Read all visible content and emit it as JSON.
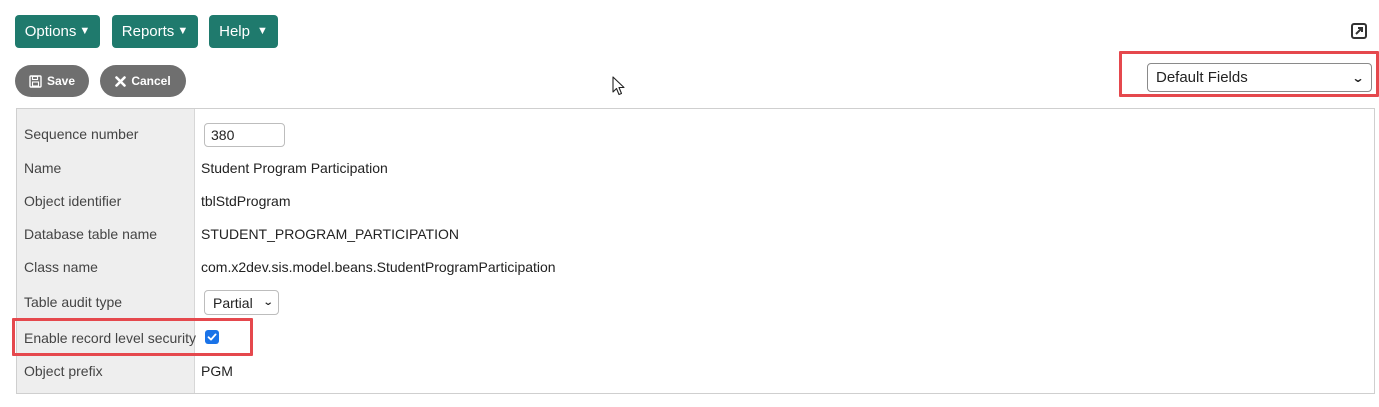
{
  "menu": {
    "options_label": "Options",
    "reports_label": "Reports",
    "help_label": "Help",
    "caret": "▼"
  },
  "toolbar": {
    "save_label": "Save",
    "cancel_label": "Cancel"
  },
  "field_set_select": {
    "selected": "Default Fields"
  },
  "form": {
    "rows": [
      {
        "label": "Sequence number",
        "value": "380"
      },
      {
        "label": "Name",
        "value": "Student Program Participation"
      },
      {
        "label": "Object identifier",
        "value": "tblStdProgram"
      },
      {
        "label": "Database table name",
        "value": "STUDENT_PROGRAM_PARTICIPATION"
      },
      {
        "label": "Class name",
        "value": "com.x2dev.sis.model.beans.StudentProgramParticipation"
      },
      {
        "label": "Table audit type",
        "value": "Partial"
      },
      {
        "label": "Enable record level security",
        "value": "checked"
      },
      {
        "label": "Object prefix",
        "value": "PGM"
      }
    ]
  },
  "colors": {
    "menu_bg": "#1f7a6d",
    "pill_bg": "#6f6f6f",
    "highlight": "#e5484d",
    "checkbox": "#1a73e8"
  },
  "icons": {
    "popout": "popout-icon",
    "save": "floppy-disk-icon",
    "cancel": "x-icon",
    "select_chevron": "chevron-down-icon"
  }
}
